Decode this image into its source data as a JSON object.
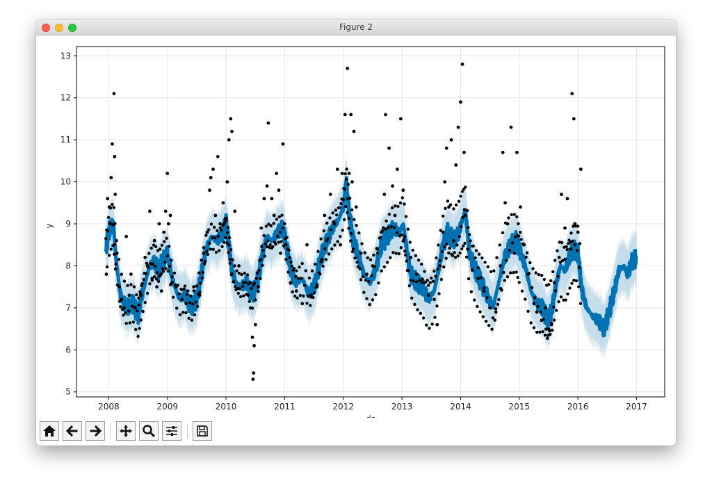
{
  "window": {
    "title": "Figure 2"
  },
  "toolbar": {
    "buttons": [
      {
        "name": "home-button",
        "icon": "home-icon"
      },
      {
        "name": "back-button",
        "icon": "arrow-left-icon"
      },
      {
        "name": "forward-button",
        "icon": "arrow-right-icon"
      },
      {
        "name": "pan-button",
        "icon": "move-icon"
      },
      {
        "name": "zoom-button",
        "icon": "magnifier-icon"
      },
      {
        "name": "configure-subplots-button",
        "icon": "sliders-icon"
      },
      {
        "name": "save-button",
        "icon": "floppy-disk-icon"
      }
    ]
  },
  "chart_data": {
    "type": "scatter",
    "title": "",
    "xlabel": "ds",
    "ylabel": "y",
    "xlim": [
      2007.45,
      2017.48
    ],
    "ylim": [
      4.88,
      13.22
    ],
    "xticks": [
      "2008",
      "2009",
      "2010",
      "2011",
      "2012",
      "2013",
      "2014",
      "2015",
      "2016",
      "2017"
    ],
    "yticks": [
      "5",
      "6",
      "7",
      "8",
      "9",
      "10",
      "11",
      "12",
      "13"
    ],
    "grid": true,
    "colors": {
      "forecast": "#0072b2",
      "uncertainty": "#c6ddec",
      "observed": "#000000"
    },
    "series": [
      {
        "role": "forecast",
        "x": [
          2007.95,
          2008.02,
          2008.08,
          2008.12,
          2008.2,
          2008.3,
          2008.42,
          2008.5,
          2008.55,
          2008.62,
          2008.7,
          2008.78,
          2008.85,
          2008.92,
          2009.0,
          2009.08,
          2009.2,
          2009.3,
          2009.4,
          2009.5,
          2009.58,
          2009.66,
          2009.75,
          2009.85,
          2009.95,
          2010.0,
          2010.05,
          2010.1,
          2010.17,
          2010.25,
          2010.35,
          2010.45,
          2010.55,
          2010.62,
          2010.7,
          2010.78,
          2010.88,
          2010.97,
          2011.05,
          2011.12,
          2011.2,
          2011.3,
          2011.42,
          2011.52,
          2011.62,
          2011.72,
          2011.82,
          2011.92,
          2012.0,
          2012.05,
          2012.1,
          2012.17,
          2012.25,
          2012.35,
          2012.45,
          2012.55,
          2012.65,
          2012.75,
          2012.85,
          2012.95,
          2013.02,
          2013.08,
          2013.15,
          2013.25,
          2013.35,
          2013.45,
          2013.55,
          2013.62,
          2013.7,
          2013.78,
          2013.88,
          2013.97,
          2014.03,
          2014.08,
          2014.15,
          2014.25,
          2014.35,
          2014.45,
          2014.55,
          2014.65,
          2014.75,
          2014.85,
          2014.95,
          2015.0,
          2015.1,
          2015.2,
          2015.3,
          2015.4,
          2015.48,
          2015.55,
          2015.62,
          2015.7,
          2015.78,
          2015.85,
          2015.92,
          2016.0,
          2016.07,
          2016.15,
          2016.25,
          2016.35,
          2016.45,
          2016.55,
          2016.62,
          2016.7,
          2016.78,
          2016.85,
          2016.92,
          2017.0
        ],
        "y": [
          8.4,
          8.9,
          9.0,
          8.2,
          7.3,
          7.0,
          7.1,
          6.8,
          7.2,
          7.6,
          8.0,
          8.1,
          7.9,
          8.1,
          8.3,
          7.7,
          7.2,
          7.3,
          7.0,
          7.2,
          7.8,
          8.4,
          8.7,
          8.6,
          8.8,
          9.0,
          8.5,
          7.9,
          7.6,
          7.5,
          7.6,
          7.3,
          7.7,
          8.3,
          8.7,
          8.6,
          8.8,
          8.9,
          8.3,
          7.8,
          7.6,
          7.7,
          7.3,
          7.6,
          8.2,
          8.6,
          8.9,
          9.1,
          9.4,
          10.0,
          9.2,
          8.6,
          8.3,
          7.8,
          7.6,
          7.9,
          8.5,
          8.7,
          8.9,
          8.8,
          9.0,
          8.4,
          7.8,
          7.6,
          7.5,
          7.2,
          7.4,
          7.9,
          8.5,
          8.8,
          8.6,
          8.8,
          9.1,
          9.3,
          8.3,
          7.9,
          7.6,
          7.3,
          7.0,
          7.6,
          8.2,
          8.5,
          8.6,
          8.4,
          8.0,
          7.4,
          7.1,
          7.0,
          6.7,
          6.9,
          7.5,
          8.0,
          7.9,
          8.2,
          8.4,
          8.3,
          7.4,
          7.0,
          6.8,
          6.7,
          6.5,
          7.0,
          7.4,
          7.9,
          8.0,
          7.8,
          8.1,
          8.2
        ]
      },
      {
        "role": "observed",
        "x": [
          2007.96,
          2007.98,
          2008.01,
          2008.04,
          2008.06,
          2008.09,
          2008.1,
          2008.11,
          2008.14,
          2008.18,
          2008.22,
          2008.26,
          2008.3,
          2008.35,
          2008.38,
          2008.45,
          2008.55,
          2008.62,
          2008.66,
          2008.7,
          2008.74,
          2008.78,
          2008.82,
          2008.86,
          2008.9,
          2008.94,
          2008.97,
          2009.0,
          2009.02,
          2009.05,
          2009.08,
          2009.15,
          2009.25,
          2009.32,
          2009.45,
          2009.55,
          2009.62,
          2009.68,
          2009.72,
          2009.74,
          2009.78,
          2009.82,
          2009.86,
          2009.9,
          2009.95,
          2010.02,
          2010.05,
          2010.08,
          2010.1,
          2010.15,
          2010.22,
          2010.3,
          2010.38,
          2010.42,
          2010.45,
          2010.46,
          2010.47,
          2010.48,
          2010.5,
          2010.55,
          2010.6,
          2010.65,
          2010.7,
          2010.72,
          2010.78,
          2010.82,
          2010.86,
          2010.9,
          2010.93,
          2010.97,
          2011.02,
          2011.1,
          2011.2,
          2011.3,
          2011.38,
          2011.45,
          2011.55,
          2011.62,
          2011.68,
          2011.72,
          2011.78,
          2011.85,
          2011.9,
          2011.95,
          2011.98,
          2012.03,
          2012.07,
          2012.1,
          2012.13,
          2012.15,
          2012.18,
          2012.22,
          2012.3,
          2012.4,
          2012.5,
          2012.58,
          2012.65,
          2012.7,
          2012.72,
          2012.78,
          2012.84,
          2012.88,
          2012.92,
          2012.98,
          2013.02,
          2013.05,
          2013.15,
          2013.25,
          2013.35,
          2013.45,
          2013.55,
          2013.6,
          2013.65,
          2013.7,
          2013.73,
          2013.76,
          2013.8,
          2013.84,
          2013.88,
          2013.92,
          2013.96,
          2014.0,
          2014.03,
          2014.06,
          2014.08,
          2014.12,
          2014.2,
          2014.3,
          2014.4,
          2014.5,
          2014.6,
          2014.68,
          2014.72,
          2014.76,
          2014.8,
          2014.86,
          2014.92,
          2014.96,
          2015.02,
          2015.08,
          2015.15,
          2015.25,
          2015.3,
          2015.38,
          2015.45,
          2015.5,
          2015.55,
          2015.6,
          2015.68,
          2015.72,
          2015.78,
          2015.82,
          2015.88,
          2015.9,
          2015.93,
          2015.95,
          2016.0,
          2016.05
        ],
        "y": [
          7.8,
          9.6,
          9.4,
          10.1,
          10.9,
          12.1,
          10.6,
          9.7,
          8.3,
          7.5,
          7.2,
          7.0,
          8.7,
          7.3,
          7.8,
          7.0,
          7.3,
          8.2,
          8.0,
          9.3,
          7.7,
          8.6,
          7.5,
          9.0,
          7.4,
          8.8,
          9.3,
          10.2,
          9.0,
          9.2,
          7.6,
          7.5,
          7.2,
          7.1,
          7.5,
          7.3,
          8.3,
          8.8,
          9.8,
          10.1,
          10.3,
          9.2,
          10.6,
          9.0,
          9.5,
          10.0,
          11.0,
          11.5,
          11.2,
          9.3,
          8.0,
          7.6,
          7.3,
          7.0,
          6.3,
          5.3,
          5.45,
          6.1,
          6.6,
          7.5,
          8.9,
          9.6,
          9.9,
          11.4,
          9.6,
          9.2,
          10.2,
          9.8,
          8.3,
          10.9,
          8.5,
          7.6,
          7.4,
          7.1,
          8.5,
          7.3,
          7.5,
          8.1,
          9.2,
          8.6,
          9.7,
          9.0,
          10.3,
          8.5,
          10.2,
          11.6,
          12.7,
          10.2,
          11.6,
          10.0,
          11.2,
          9.4,
          8.3,
          7.8,
          8.0,
          8.4,
          8.8,
          9.7,
          11.6,
          10.8,
          9.9,
          9.2,
          10.3,
          11.5,
          9.8,
          8.7,
          8.2,
          7.8,
          7.6,
          7.3,
          7.2,
          6.6,
          8.0,
          8.8,
          10.0,
          10.8,
          9.4,
          11.0,
          8.6,
          10.4,
          11.3,
          11.9,
          12.8,
          10.7,
          9.2,
          8.4,
          7.9,
          7.7,
          7.4,
          7.0,
          6.9,
          8.0,
          10.7,
          9.5,
          9.0,
          11.3,
          8.3,
          10.7,
          9.4,
          8.5,
          7.8,
          7.1,
          6.9,
          6.7,
          7.0,
          6.5,
          6.6,
          7.6,
          8.2,
          9.7,
          8.9,
          9.6,
          8.4,
          12.1,
          11.5,
          9.0,
          8.8,
          10.3
        ]
      }
    ]
  }
}
